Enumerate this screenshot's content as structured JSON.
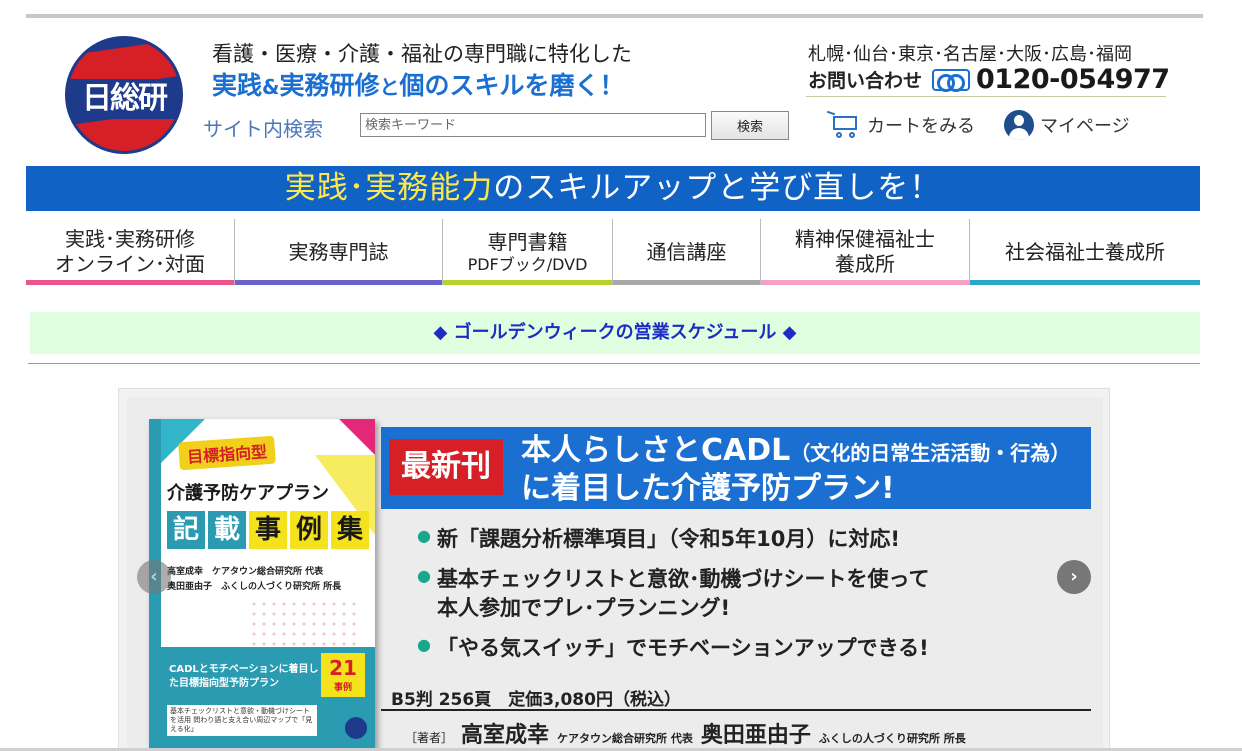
{
  "logo": {
    "text": "日総研"
  },
  "header": {
    "tagline_line1": "看護・医療・介護・福祉の専門職に特化した",
    "tagline_line2_a": "実践",
    "tagline_line2_amp": "&",
    "tagline_line2_b": "実務研修",
    "tagline_line2_to": "と",
    "tagline_line2_c": "個のスキルを磨く！",
    "cities": "札幌･仙台･東京･名古屋･大阪･広島･福岡",
    "contact_label": "お問い合わせ",
    "phone": "0120-054977"
  },
  "search": {
    "label": "サイト内検索",
    "placeholder": "検索キーワード",
    "button_label": "検索"
  },
  "links": {
    "cart": "カートをみる",
    "mypage": "マイページ"
  },
  "hero_band": {
    "part1": "実践",
    "part2": "･",
    "part3": "実務能力",
    "part4": "のスキルアップ",
    "part5": "と学び直しを！"
  },
  "nav": {
    "items": [
      {
        "line1": "実践･実務研修",
        "line2": "オンライン･対面",
        "color": "#e8558f"
      },
      {
        "line1": "実務専門誌",
        "line2": "",
        "color": "#6a63c9"
      },
      {
        "line1": "専門書籍",
        "line2": "PDFブック/DVD",
        "color": "#b8d22c"
      },
      {
        "line1": "通信講座",
        "line2": "",
        "color": "#a8a8a8"
      },
      {
        "line1": "精神保健福祉士",
        "line2": "養成所",
        "color": "#f4a0c8"
      },
      {
        "line1": "社会福祉士養成所",
        "line2": "",
        "color": "#2aa8c8"
      }
    ]
  },
  "notice": {
    "text": "◆ ゴールデンウィークの営業スケジュール ◆"
  },
  "slide": {
    "book": {
      "badge": "目標指向型",
      "title1": "介護予防ケアプラン",
      "title2_chars": [
        "記",
        "載",
        "事",
        "例",
        "集"
      ],
      "author1": "高室成幸　ケアタウン総合研究所 代表",
      "author2": "奥田亜由子　ふくしの人づくり研究所 所長",
      "box_text": "CADLとモチベーションに着目した目標指向型予防プラン",
      "box_count": "21",
      "box_count_unit": "事例",
      "box_strip": "基本チェックリストと意欲・動機づけシートを活用 問わり語と支え合い周辺マップで「見える化」"
    },
    "tag": "最新刊",
    "title_line1": "本人らしさとCADL",
    "title_paren": "（文化的日常生活活動・行為）",
    "title_line2": "に着目した介護予防プラン!",
    "bullets": [
      "新「課題分析標準項目」（令和5年10月）に対応!",
      "基本チェックリストと意欲･動機づけシートを使って\n本人参加でプレ･プランニング!",
      "「やる気スイッチ」でモチベーションアップできる!"
    ],
    "spec": "B5判 256頁　定価3,080円（税込）",
    "author_prefix": "［著者］",
    "author1_name": "高室成幸",
    "author1_org": "ケアタウン総合研究所 代表",
    "author2_name": "奥田亜由子",
    "author2_org": "ふくしの人づくり研究所 所長"
  },
  "colors": {
    "brand_blue": "#1063c4",
    "brand_red": "#d61f26",
    "notice_bg": "#dfffe0",
    "notice_text": "#1c2cc4"
  }
}
